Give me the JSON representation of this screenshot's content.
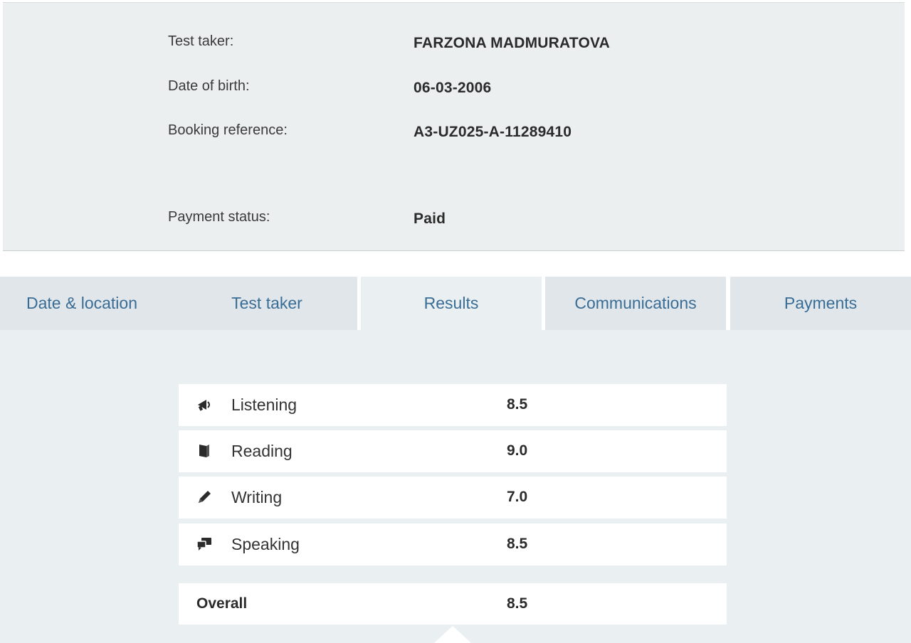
{
  "candidate": {
    "test_taker_label": "Test taker:",
    "test_taker_value": "FARZONA MADMURATOVA",
    "dob_label": "Date of birth:",
    "dob_value": "06-03-2006",
    "booking_label": "Booking reference:",
    "booking_value": "A3-UZ025-A-11289410",
    "payment_label": "Payment status:",
    "payment_value": "Paid"
  },
  "tabs": [
    {
      "label": "Date & location",
      "active": false
    },
    {
      "label": "Test taker",
      "active": false
    },
    {
      "label": "Results",
      "active": true
    },
    {
      "label": "Communications",
      "active": false
    },
    {
      "label": "Payments",
      "active": false
    }
  ],
  "results": {
    "rows": [
      {
        "label": "Listening",
        "score": "8.5",
        "icon": "megaphone-icon"
      },
      {
        "label": "Reading",
        "score": "9.0",
        "icon": "book-icon"
      },
      {
        "label": "Writing",
        "score": "7.0",
        "icon": "pencil-icon"
      },
      {
        "label": "Speaking",
        "score": "8.5",
        "icon": "speech-bubbles-icon"
      }
    ],
    "overall_label": "Overall",
    "overall_score": "8.5"
  },
  "colors": {
    "panel_bg": "#ebeff0",
    "tab_text": "#3a6d96",
    "tab_bg": "#e0e6e9"
  }
}
